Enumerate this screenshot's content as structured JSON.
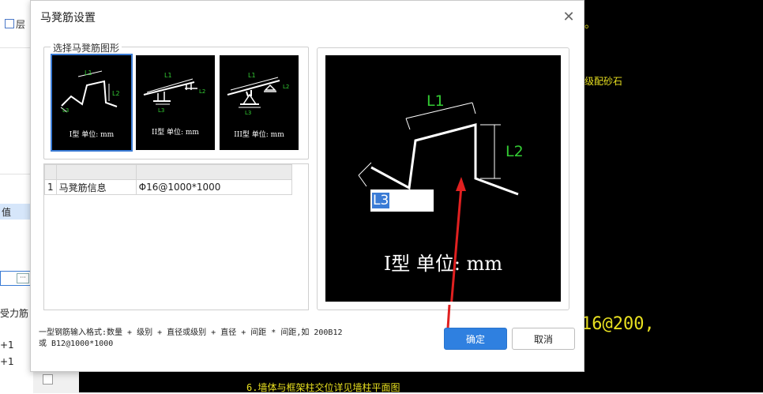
{
  "background": {
    "top_tab_label": "层",
    "left_cells": [
      "值",
      "受力筋",
      "+1",
      "+1"
    ],
    "cad_annotations": {
      "top_right_mark": "。",
      "right_text_1": "级配砂石",
      "right_text_2": "16@200,",
      "bottom_text": "6.墙体与框架柱交位详见墙柱平面图"
    }
  },
  "dialog": {
    "title": "马凳筋设置",
    "group_label": "选择马凳筋图形",
    "shapes": [
      {
        "name": "I型 单位: mm",
        "l1": "L1",
        "l2": "L2",
        "l3": "L3",
        "selected": true
      },
      {
        "name": "II型 单位: mm",
        "l1": "L1",
        "l2": "L2",
        "l3": "L3",
        "selected": false
      },
      {
        "name": "III型 单位: mm",
        "l1": "L1",
        "l2": "L2",
        "l3": "L3",
        "selected": false
      }
    ],
    "table": {
      "rows": [
        {
          "index": "1",
          "name": "马凳筋信息",
          "value": "Φ16@1000*1000"
        }
      ]
    },
    "preview": {
      "l1": "L1",
      "l2": "L2",
      "l3_input": "L3",
      "caption": "I型 单位: mm"
    },
    "hint_line1": "一型钢筋输入格式:数量 + 级别 + 直径或级别 + 直径 + 间距 * 间距,如 200B12",
    "hint_line2": "或 B12@1000*1000",
    "ok_label": "确定",
    "cancel_label": "取消"
  },
  "colors": {
    "accent": "#2f80e0",
    "cad_yellow": "#e8e020",
    "dim_green": "#33cc33",
    "arrow_red": "#e02020"
  }
}
